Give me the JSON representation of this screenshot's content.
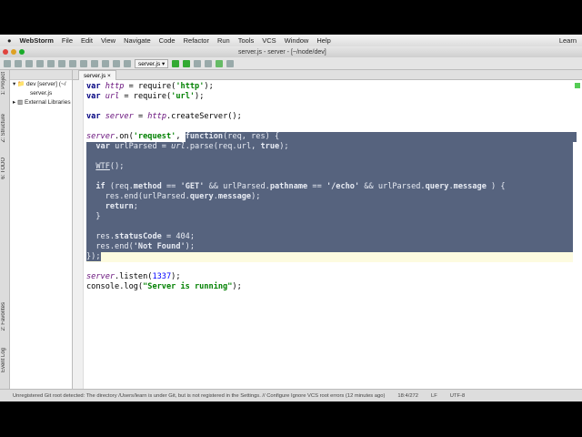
{
  "menubar": {
    "app": "WebStorm",
    "items": [
      "File",
      "Edit",
      "View",
      "Navigate",
      "Code",
      "Refactor",
      "Run",
      "Tools",
      "VCS",
      "Window",
      "Help"
    ],
    "user": "Learn"
  },
  "window": {
    "title": "server.js - server - [~/node/dev]"
  },
  "toolbar": {
    "run_config": "server.js ▾"
  },
  "sidebar": {
    "tabs": [
      "1: Project",
      "Z: Structure",
      "6: TODO",
      "2: Favorites",
      "Event Log"
    ]
  },
  "project": {
    "items": [
      "dev [server] (~/",
      "server.js",
      "External Libraries"
    ]
  },
  "editor": {
    "tab": "server.js ×"
  },
  "status": {
    "message": "Unregistered Git root detected: The directory /Users/learn is under Git, but is not registered in the Settings. // Configure  Ignore VCS root errors (12 minutes ago)",
    "position": "18:4/272",
    "line_sep": "LF",
    "encoding": "UTF-8"
  }
}
